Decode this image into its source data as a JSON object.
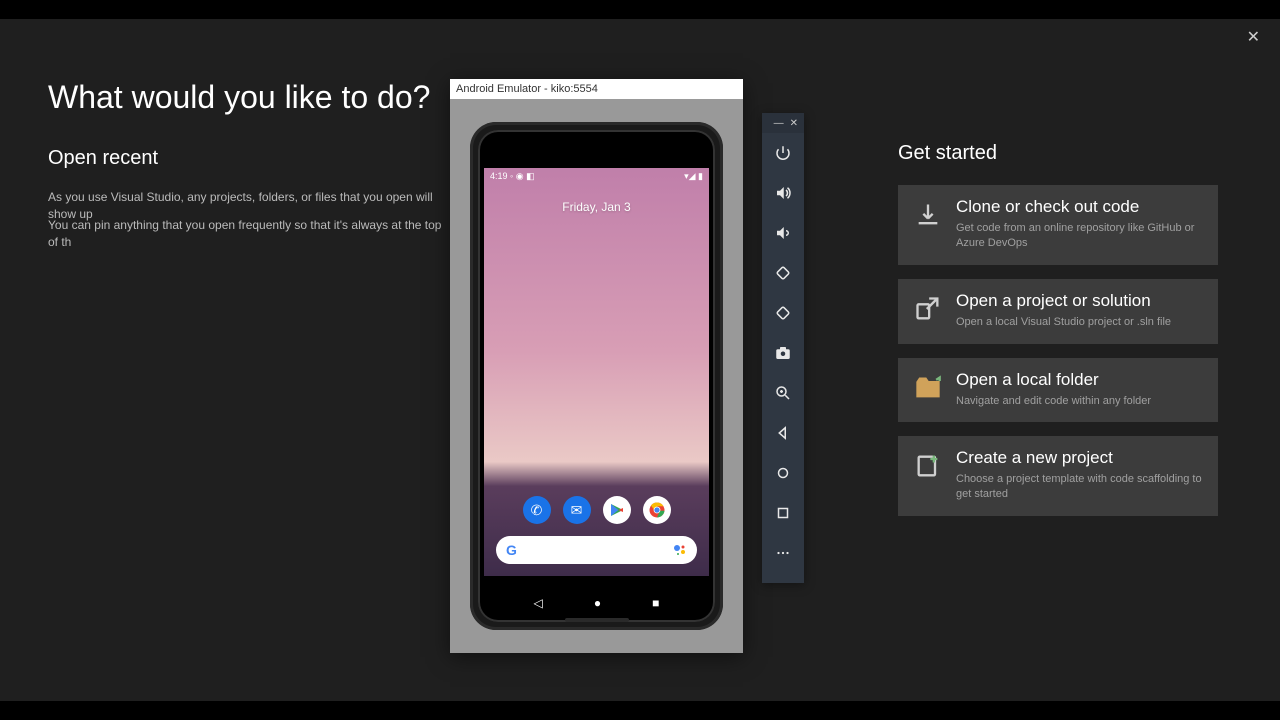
{
  "window": {
    "close_icon": "✕"
  },
  "heading": "What would you like to do?",
  "recent": {
    "title": "Open recent",
    "line1": "As you use Visual Studio, any projects, folders, or files that you open will show up",
    "line2": "You can pin anything that you open frequently so that it's always at the top of th"
  },
  "get_started": {
    "title": "Get started",
    "cards": [
      {
        "title": "Clone or check out code",
        "desc": "Get code from an online repository like GitHub or Azure DevOps"
      },
      {
        "title": "Open a project or solution",
        "desc": "Open a local Visual Studio project or .sln file"
      },
      {
        "title": "Open a local folder",
        "desc": "Navigate and edit code within any folder"
      },
      {
        "title": "Create a new project",
        "desc": "Choose a project template with code scaffolding to get started"
      }
    ]
  },
  "emulator": {
    "title": "Android Emulator - kiko:5554",
    "status_time": "4:19",
    "date": "Friday, Jan 3",
    "google": "Google"
  }
}
